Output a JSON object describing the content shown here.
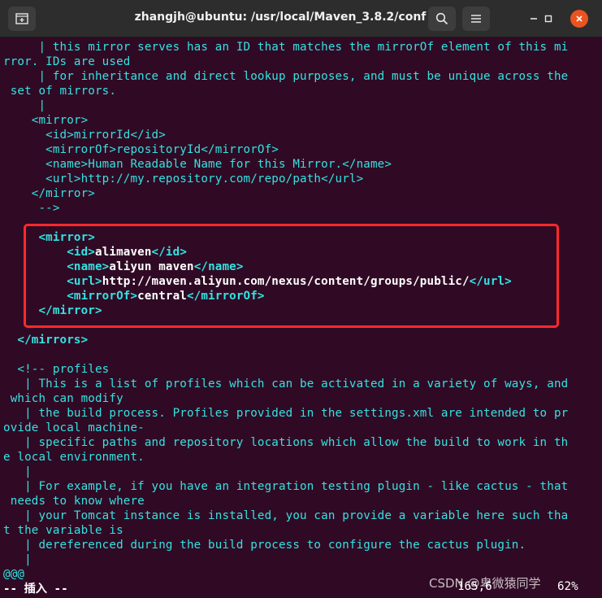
{
  "window": {
    "title": "zhangjh@ubuntu: /usr/local/Maven_3.8.2/conf",
    "icons": {
      "new_tab": "new-tab-icon",
      "search": "search-icon",
      "menu": "hamburger-menu-icon",
      "minimize": "minimize-icon",
      "maximize": "maximize-icon",
      "close": "close-icon"
    },
    "colors": {
      "titlebar": "#2d2d2d",
      "background": "#300a24",
      "cyan": "#34e2e2",
      "close": "#e95420",
      "highlight": "#ff2a2a"
    }
  },
  "terminal": {
    "lines": [
      {
        "lead": "     | this mirror serves has an ID that matches the mirrorOf element of this mi"
      },
      {
        "lead": "rror. IDs are used"
      },
      {
        "lead": "     | for inheritance and direct lookup purposes, and must be unique across the"
      },
      {
        "lead": " set of mirrors."
      },
      {
        "lead": "     |"
      },
      {
        "lead": "    <mirror>"
      },
      {
        "lead": "      <id>mirrorId</id>"
      },
      {
        "lead": "      <mirrorOf>repositoryId</mirrorOf>"
      },
      {
        "lead": "      <name>Human Readable Name for this Mirror.</name>"
      },
      {
        "lead": "      <url>http://my.repository.com/repo/path</url>"
      },
      {
        "lead": "    </mirror>"
      },
      {
        "lead": "     -->"
      },
      {
        "lead": ""
      },
      {
        "tag1": "     <mirror>",
        "text": "",
        "tag2": ""
      },
      {
        "tag1": "         <id>",
        "text": "alimaven",
        "tag2": "</id>"
      },
      {
        "tag1": "         <name>",
        "text": "aliyun maven",
        "tag2": "</name>"
      },
      {
        "tag1": "         <url>",
        "text": "http://maven.aliyun.com/nexus/content/groups/public/",
        "tag2": "</url>"
      },
      {
        "tag1": "         <mirrorOf>",
        "text": "central",
        "tag2": "</mirrorOf>"
      },
      {
        "tag1": "     </mirror>",
        "text": "",
        "tag2": ""
      },
      {
        "lead": ""
      },
      {
        "tag1": "  </mirrors>",
        "text": "",
        "tag2": ""
      },
      {
        "lead": ""
      },
      {
        "lead": "  <!-- profiles"
      },
      {
        "lead": "   | This is a list of profiles which can be activated in a variety of ways, and"
      },
      {
        "lead": " which can modify"
      },
      {
        "lead": "   | the build process. Profiles provided in the settings.xml are intended to pr"
      },
      {
        "lead": "ovide local machine-"
      },
      {
        "lead": "   | specific paths and repository locations which allow the build to work in th"
      },
      {
        "lead": "e local environment."
      },
      {
        "lead": "   |"
      },
      {
        "lead": "   | For example, if you have an integration testing plugin - like cactus - that"
      },
      {
        "lead": " needs to know where"
      },
      {
        "lead": "   | your Tomcat instance is installed, you can provide a variable here such tha"
      },
      {
        "lead": "t the variable is"
      },
      {
        "lead": "   | dereferenced during the build process to configure the cactus plugin."
      },
      {
        "lead": "   |"
      },
      {
        "lead": "@@@"
      }
    ]
  },
  "status": {
    "mode": "-- 插入 --",
    "position": "165,6",
    "percent": "62%"
  },
  "watermark": "CSDN @卑微猿同学"
}
